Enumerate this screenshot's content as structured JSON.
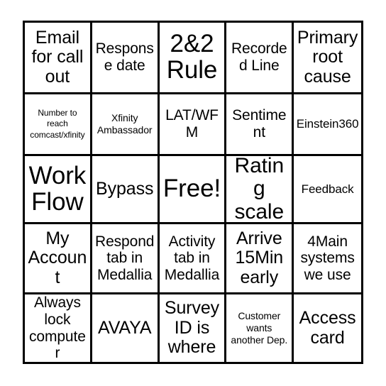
{
  "card": {
    "type": "bingo-card",
    "grid": {
      "columns": 5,
      "rows": 5
    },
    "colors": {
      "border": "#000000",
      "background": "#ffffff",
      "text": "#000000"
    },
    "free_space_index": 12,
    "cells": [
      {
        "text": "Email for call out",
        "size": "lg"
      },
      {
        "text": "Response date",
        "size": "md"
      },
      {
        "text": "2&2 Rule",
        "size": "xxl"
      },
      {
        "text": "Recorded Line",
        "size": "md"
      },
      {
        "text": "Primary root cause",
        "size": "lg"
      },
      {
        "text": "Number to reach comcast/xfinity",
        "size": "xxs"
      },
      {
        "text": "Xfinity Ambassador",
        "size": "xs"
      },
      {
        "text": "LAT/WFM",
        "size": "md"
      },
      {
        "text": "Sentiment",
        "size": "md"
      },
      {
        "text": "Einstein360",
        "size": "sm"
      },
      {
        "text": "Work Flow",
        "size": "xxl"
      },
      {
        "text": "Bypass",
        "size": "lg"
      },
      {
        "text": "Free!",
        "size": "xxl"
      },
      {
        "text": "Rating scale",
        "size": "xl"
      },
      {
        "text": "Feedback",
        "size": "sm"
      },
      {
        "text": "My Account",
        "size": "lg"
      },
      {
        "text": "Respond tab in Medallia",
        "size": "md"
      },
      {
        "text": "Activity tab in Medallia",
        "size": "md"
      },
      {
        "text": "Arrive 15Min early",
        "size": "lg"
      },
      {
        "text": "4Main systems we use",
        "size": "md"
      },
      {
        "text": "Always lock computer",
        "size": "md"
      },
      {
        "text": "AVAYA",
        "size": "lg"
      },
      {
        "text": "Survey ID is where",
        "size": "lg"
      },
      {
        "text": "Customer wants another Dep.",
        "size": "xs"
      },
      {
        "text": "Access card",
        "size": "lg"
      }
    ]
  }
}
